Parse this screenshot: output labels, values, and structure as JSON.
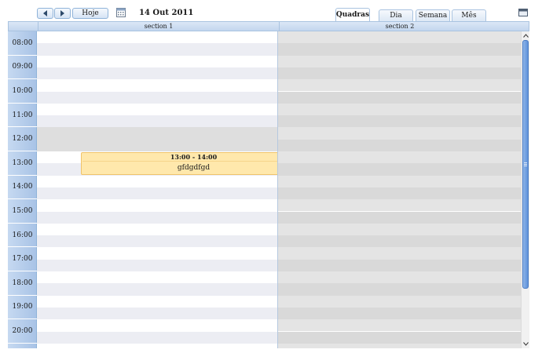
{
  "toolbar": {
    "prev_label": "◀",
    "next_label": "▶",
    "today_label": "Hoje",
    "calendar_icon": "calendar-icon",
    "date": "14 Out 2011"
  },
  "tabs": [
    {
      "label": "Quadras",
      "active": true
    },
    {
      "label": "Dia",
      "active": false
    },
    {
      "label": "Semana",
      "active": false
    },
    {
      "label": "Mês",
      "active": false
    }
  ],
  "sections": [
    "section 1",
    "section 2"
  ],
  "hours": [
    "08:00",
    "09:00",
    "10:00",
    "11:00",
    "12:00",
    "13:00",
    "14:00",
    "15:00",
    "16:00",
    "17:00",
    "18:00",
    "19:00",
    "20:00"
  ],
  "event": {
    "time": "13:00 - 14:00",
    "text": "gfdgdfgd",
    "section": "section 1"
  },
  "colors": {
    "event_bg": "#ffe8ac",
    "event_border": "#f0c36a",
    "time_column": "#b9cfec",
    "header": "#c3d6ee"
  },
  "blocked_hours_section1": [
    "12:00"
  ]
}
